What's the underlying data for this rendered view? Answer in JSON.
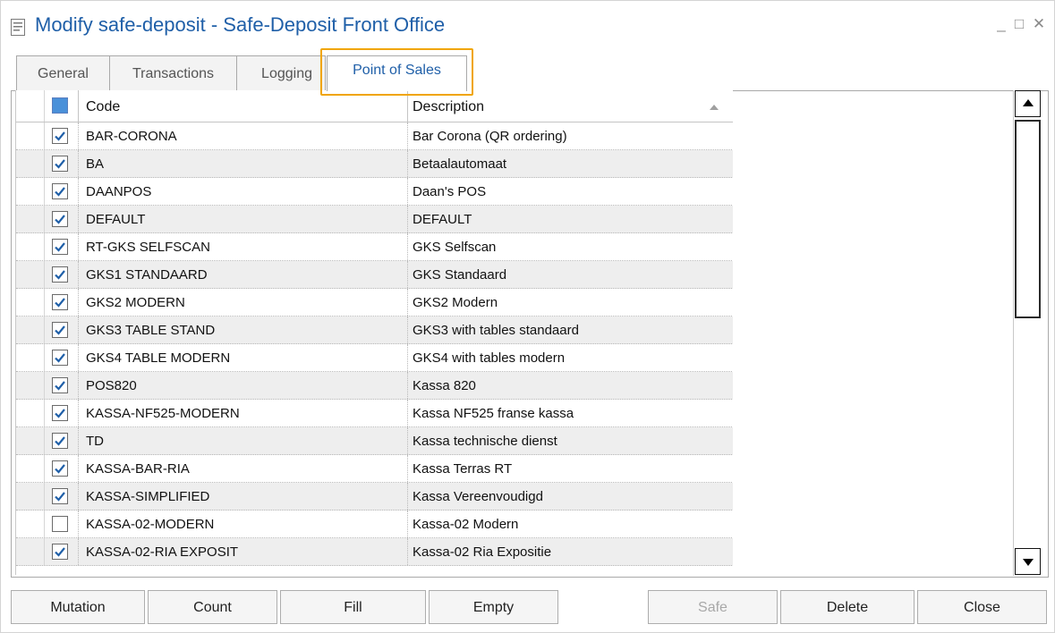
{
  "window": {
    "title": "Modify safe-deposit - Safe-Deposit Front Office",
    "minimize_label": "_",
    "maximize_label": "□",
    "close_label": "✕"
  },
  "tabs": [
    {
      "label": "General"
    },
    {
      "label": "Transactions"
    },
    {
      "label": "Logging"
    },
    {
      "label": "Point of Sales",
      "active": true
    }
  ],
  "grid": {
    "columns": {
      "code": "Code",
      "description": "Description"
    },
    "header_checked": true,
    "rows": [
      {
        "checked": true,
        "code": "BAR-CORONA",
        "description": "Bar Corona (QR ordering)"
      },
      {
        "checked": true,
        "code": "BA",
        "description": "Betaalautomaat"
      },
      {
        "checked": true,
        "code": "DAANPOS",
        "description": "Daan's POS"
      },
      {
        "checked": true,
        "code": "DEFAULT",
        "description": "DEFAULT"
      },
      {
        "checked": true,
        "code": "RT-GKS SELFSCAN",
        "description": "GKS Selfscan"
      },
      {
        "checked": true,
        "code": "GKS1 STANDAARD",
        "description": "GKS Standaard"
      },
      {
        "checked": true,
        "code": "GKS2 MODERN",
        "description": "GKS2 Modern"
      },
      {
        "checked": true,
        "code": "GKS3 TABLE STAND",
        "description": "GKS3 with tables standaard"
      },
      {
        "checked": true,
        "code": "GKS4 TABLE MODERN",
        "description": "GKS4 with tables modern"
      },
      {
        "checked": true,
        "code": "POS820",
        "description": "Kassa 820"
      },
      {
        "checked": true,
        "code": "KASSA-NF525-MODERN",
        "description": "Kassa NF525 franse kassa"
      },
      {
        "checked": true,
        "code": "TD",
        "description": "Kassa technische dienst"
      },
      {
        "checked": true,
        "code": "KASSA-BAR-RIA",
        "description": "Kassa Terras RT"
      },
      {
        "checked": true,
        "code": "KASSA-SIMPLIFIED",
        "description": "Kassa Vereenvoudigd"
      },
      {
        "checked": false,
        "code": "KASSA-02-MODERN",
        "description": "Kassa-02 Modern"
      },
      {
        "checked": true,
        "code": "KASSA-02-RIA EXPOSIT",
        "description": "Kassa-02 Ria Expositie"
      }
    ]
  },
  "buttons": {
    "mutation": "Mutation",
    "count": "Count",
    "fill": "Fill",
    "empty": "Empty",
    "safe": "Safe",
    "delete": "Delete",
    "close": "Close"
  },
  "colors": {
    "title": "#1f5fa8",
    "tab_highlight": "#f0a500",
    "row_alt": "#eeeeee"
  }
}
